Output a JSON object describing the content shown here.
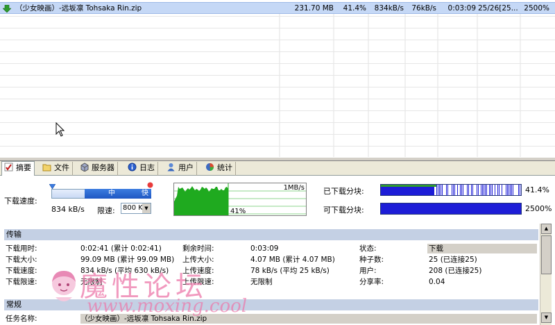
{
  "download_row": {
    "name": "（少女映画）-远坂凛 Tohsaka Rin.zip",
    "size": "231.70 MB",
    "progress": "41.4%",
    "down_speed": "834kB/s",
    "up_speed": "76kB/s",
    "eta": "0:03:09",
    "seeds": "25/26[25...",
    "ratio": "2500%"
  },
  "tabs": [
    {
      "label": "摘要",
      "icon": "checklist-icon"
    },
    {
      "label": "文件",
      "icon": "folder-icon"
    },
    {
      "label": "服务器",
      "icon": "server-icon"
    },
    {
      "label": "日志",
      "icon": "info-icon"
    },
    {
      "label": "用户",
      "icon": "user-icon"
    },
    {
      "label": "统计",
      "icon": "stats-icon"
    }
  ],
  "speed": {
    "label": "下载速度:",
    "value": "834 kB/s",
    "limit_label": "限速:",
    "limit_value": "800 KB",
    "slider_mid": "中",
    "slider_fast": "快"
  },
  "graph": {
    "max_label": "1MB/s",
    "percent": "41%",
    "progress": 0.41
  },
  "pieces": {
    "downloaded_label": "已下载分块:",
    "downloaded_value": "41.4%",
    "available_label": "可下载分块:",
    "available_value": "2500%"
  },
  "transfer": {
    "header": "传输",
    "rows": [
      {
        "k1": "下载用时:",
        "v1": "0:02:41 (累计 0:02:41)",
        "k2": "剩余时间:",
        "v2": "0:03:09",
        "k3": "状态:",
        "v3": "下载"
      },
      {
        "k1": "下载大小:",
        "v1": "99.09 MB (累计 99.09 MB)",
        "k2": "上传大小:",
        "v2": "4.07 MB (累计 4.07 MB)",
        "k3": "种子数:",
        "v3": "25 (已连接25)"
      },
      {
        "k1": "下载速度:",
        "v1": "834 kB/s (平均 630 kB/s)",
        "k2": "上传速度:",
        "v2": "78 kB/s (平均 25 kB/s)",
        "k3": "用户:",
        "v3": "208 (已连接25)"
      },
      {
        "k1": "下载限速:",
        "v1": "无限制",
        "k2": "上传限速:",
        "v2": "无限制",
        "k3": "分享率:",
        "v3": "0.04"
      }
    ]
  },
  "general": {
    "header": "常规",
    "task_name_label": "任务名称:",
    "task_name_value": "（少女映画）-远坂凛 Tohsaka Rin.zip"
  },
  "watermark": {
    "title": "魔性论坛",
    "url": "www.moxing.cool"
  },
  "colors": {
    "selected_row": "#c5d8f6",
    "graph_fill": "#1faa1f",
    "piece_bar": "#1d1dd7",
    "section_header": "#c4d0e4"
  }
}
